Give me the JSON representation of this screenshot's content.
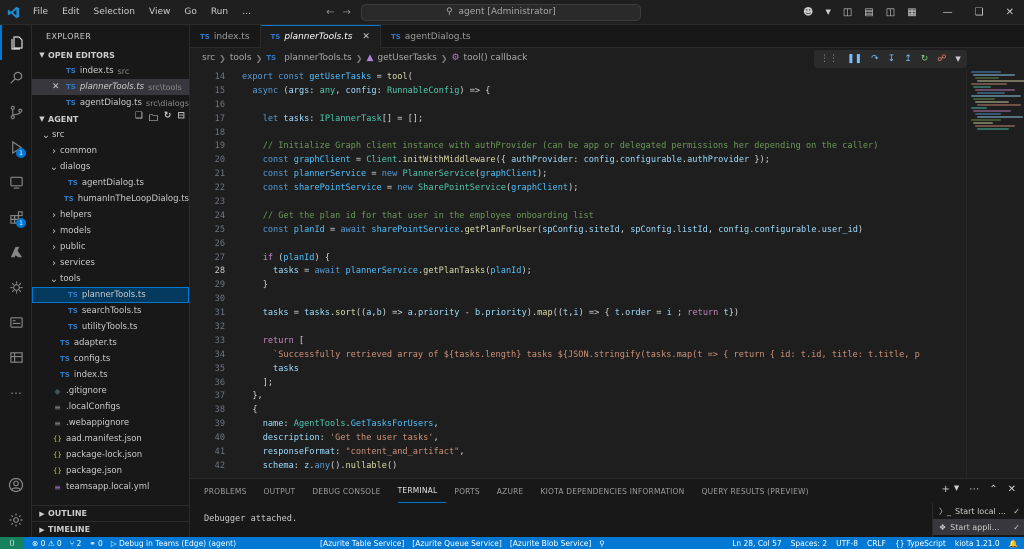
{
  "titlebar": {
    "menu": [
      "File",
      "Edit",
      "Selection",
      "View",
      "Go",
      "Run",
      "…"
    ],
    "search": "agent [Administrator]",
    "colors": {
      "bg": "#1f1f1f",
      "accent": "#0078d4"
    }
  },
  "activity": {
    "icons": [
      "files-icon",
      "search-icon",
      "source-control-icon",
      "run-debug-icon",
      "remote-explorer-icon",
      "extensions-icon",
      "azure-icon",
      "teams-toolkit-icon",
      "kiota-icon",
      "database-icon",
      "more-icon",
      "account-icon",
      "settings-icon"
    ],
    "debug_badge": "1",
    "extensions_badge": "1"
  },
  "sidebar": {
    "title": "EXPLORER",
    "open_editors_label": "OPEN EDITORS",
    "open_editors": [
      {
        "name": "index.ts",
        "desc": "src"
      },
      {
        "name": "plannerTools.ts",
        "desc": "src\\tools"
      },
      {
        "name": "agentDialog.ts",
        "desc": "src\\dialogs"
      }
    ],
    "workspace_label": "AGENT",
    "tree": [
      {
        "name": "src",
        "kind": "folder-open",
        "indent": 0
      },
      {
        "name": "common",
        "kind": "folder",
        "indent": 1
      },
      {
        "name": "dialogs",
        "kind": "folder-open",
        "indent": 1
      },
      {
        "name": "agentDialog.ts",
        "kind": "ts",
        "indent": 2
      },
      {
        "name": "humanInTheLoopDialog.ts",
        "kind": "ts",
        "indent": 2
      },
      {
        "name": "helpers",
        "kind": "folder",
        "indent": 1
      },
      {
        "name": "models",
        "kind": "folder",
        "indent": 1
      },
      {
        "name": "public",
        "kind": "folder",
        "indent": 1
      },
      {
        "name": "services",
        "kind": "folder",
        "indent": 1
      },
      {
        "name": "tools",
        "kind": "folder-open",
        "indent": 1
      },
      {
        "name": "plannerTools.ts",
        "kind": "ts",
        "indent": 2,
        "focus": true
      },
      {
        "name": "searchTools.ts",
        "kind": "ts",
        "indent": 2
      },
      {
        "name": "utilityTools.ts",
        "kind": "ts",
        "indent": 2
      },
      {
        "name": "adapter.ts",
        "kind": "ts",
        "indent": 1
      },
      {
        "name": "config.ts",
        "kind": "ts",
        "indent": 1
      },
      {
        "name": "index.ts",
        "kind": "ts",
        "indent": 1
      },
      {
        "name": ".gitignore",
        "kind": "git",
        "indent": 0
      },
      {
        "name": ".localConfigs",
        "kind": "file",
        "indent": 0
      },
      {
        "name": ".webappignore",
        "kind": "file",
        "indent": 0
      },
      {
        "name": "aad.manifest.json",
        "kind": "json",
        "indent": 0
      },
      {
        "name": "package-lock.json",
        "kind": "json",
        "indent": 0
      },
      {
        "name": "package.json",
        "kind": "json",
        "indent": 0
      },
      {
        "name": "teamsapp.local.yml",
        "kind": "yml",
        "indent": 0
      }
    ],
    "outline_label": "OUTLINE",
    "timeline_label": "TIMELINE"
  },
  "tabs": [
    {
      "name": "index.ts",
      "active": false
    },
    {
      "name": "plannerTools.ts",
      "active": true
    },
    {
      "name": "agentDialog.ts",
      "active": false
    }
  ],
  "breadcrumb": [
    "src",
    "tools",
    "plannerTools.ts",
    "getUserTasks",
    "tool() callback"
  ],
  "code": {
    "current_line": "28",
    "lines": [
      {
        "n": "14",
        "t": "export const getUserTasks = tool("
      },
      {
        "n": "15",
        "t": "  async (args: any, config: RunnableConfig) => {"
      },
      {
        "n": "16",
        "t": ""
      },
      {
        "n": "17",
        "t": "    let tasks: IPlannerTask[] = [];"
      },
      {
        "n": "18",
        "t": ""
      },
      {
        "n": "19",
        "t": "    // Initialize Graph client instance with authProvider (can be app or delegated permissions her depending on the caller)"
      },
      {
        "n": "20",
        "t": "    const graphClient = Client.initWithMiddleware({ authProvider: config.configurable.authProvider });"
      },
      {
        "n": "21",
        "t": "    const plannerService = new PlannerService(graphClient);"
      },
      {
        "n": "22",
        "t": "    const sharePointService = new SharePointService(graphClient);"
      },
      {
        "n": "23",
        "t": ""
      },
      {
        "n": "24",
        "t": "    // Get the plan id for that user in the employee onboarding list"
      },
      {
        "n": "25",
        "t": "    const planId = await sharePointService.getPlanForUser(spConfig.siteId, spConfig.listId, config.configurable.user_id)"
      },
      {
        "n": "26",
        "t": ""
      },
      {
        "n": "27",
        "t": "    if (planId) {"
      },
      {
        "n": "28",
        "t": "      tasks = await plannerService.getPlanTasks(planId);"
      },
      {
        "n": "29",
        "t": "    }"
      },
      {
        "n": "30",
        "t": ""
      },
      {
        "n": "31",
        "t": "    tasks = tasks.sort((a,b) => a.priority - b.priority).map((t,i) => { t.order = i ; return t})"
      },
      {
        "n": "32",
        "t": ""
      },
      {
        "n": "33",
        "t": "    return ["
      },
      {
        "n": "34",
        "t": "      `Successfully retrieved array of ${tasks.length} tasks ${JSON.stringify(tasks.map(t => { return { id: t.id, title: t.title, p"
      },
      {
        "n": "35",
        "t": "      tasks"
      },
      {
        "n": "36",
        "t": "    ];"
      },
      {
        "n": "37",
        "t": "  },"
      },
      {
        "n": "38",
        "t": "  {"
      },
      {
        "n": "39",
        "t": "    name: AgentTools.GetTasksForUsers,"
      },
      {
        "n": "40",
        "t": "    description: 'Get the user tasks',"
      },
      {
        "n": "41",
        "t": "    responseFormat: \"content_and_artifact\","
      },
      {
        "n": "42",
        "t": "    schema: z.any().nullable()"
      }
    ]
  },
  "panel": {
    "tabs": [
      "PROBLEMS",
      "OUTPUT",
      "DEBUG CONSOLE",
      "TERMINAL",
      "PORTS",
      "AZURE",
      "KIOTA DEPENDENCIES INFORMATION",
      "QUERY RESULTS (PREVIEW)"
    ],
    "active_tab": "TERMINAL",
    "output": "Debugger attached.",
    "terminals": [
      "Start local ...",
      "Start appli..."
    ]
  },
  "statusbar": {
    "problems": "⊗ 0 ⚠ 0",
    "workers": "⑂ 2",
    "ports": "⚭ 0",
    "debug": "Debug in Teams (Edge) (agent)",
    "azurite": [
      "[Azurite Table Service]",
      "[Azurite Queue Service]",
      "[Azurite Blob Service]"
    ],
    "position": "Ln 28, Col 57",
    "spaces": "Spaces: 2",
    "encoding": "UTF-8",
    "eol": "CRLF",
    "language": "{} TypeScript",
    "kiota": "kiota 1.21.0"
  }
}
